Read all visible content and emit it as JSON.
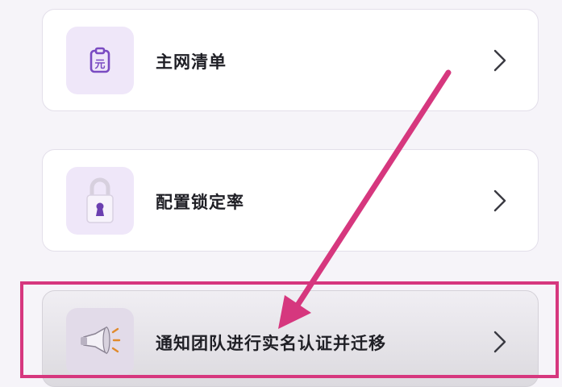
{
  "menu": {
    "items": [
      {
        "label": "主网清单",
        "icon": "receipt-yuan-icon"
      },
      {
        "label": "配置锁定率",
        "icon": "padlock-icon"
      },
      {
        "label": "通知团队进行实名认证并迁移",
        "icon": "megaphone-icon"
      }
    ]
  },
  "annotation": {
    "color": "#d6377e",
    "highlight_target": "通知团队进行实名认证并迁移"
  },
  "colors": {
    "accent": "#7a4bc2",
    "icon_tile": "#efe7f9",
    "text": "#1f1f25"
  }
}
